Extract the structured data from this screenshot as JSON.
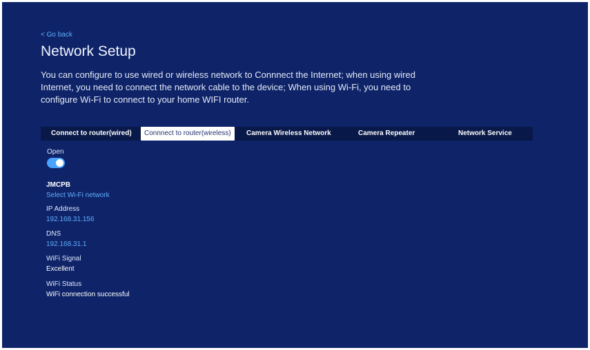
{
  "header": {
    "back_label": "< Go back",
    "title": "Network Setup",
    "description": "You can configure to use wired or wireless network to Connnect the Internet; when using wired Internet, you need to connect the network cable to the device; When using Wi-Fi, you need to configure Wi-Fi to connect to your home WIFI router."
  },
  "tabs": [
    {
      "label": "Connect to router(wired)",
      "active": false
    },
    {
      "label": "Connnect to router(wireless)",
      "active": true
    },
    {
      "label": "Camera Wireless Network",
      "active": false
    },
    {
      "label": "Camera Repeater",
      "active": false
    },
    {
      "label": "Network Service",
      "active": false
    }
  ],
  "wireless": {
    "open_label": "Open",
    "open_enabled": true,
    "network_name": "JMCPB",
    "select_network_link": "Select Wi-Fi network",
    "ip_label": "IP Address",
    "ip_value": "192.168.31.156",
    "dns_label": "DNS",
    "dns_value": "192.168.31.1",
    "signal_label": "WiFi Signal",
    "signal_value": "Excellent",
    "status_label": "WiFi Status",
    "status_value": "WiFi connection successful"
  },
  "colors": {
    "background": "#0f2468",
    "tab_bar": "#081848",
    "accent_link": "#5fb0ff",
    "toggle_on": "#4aa3ff"
  }
}
